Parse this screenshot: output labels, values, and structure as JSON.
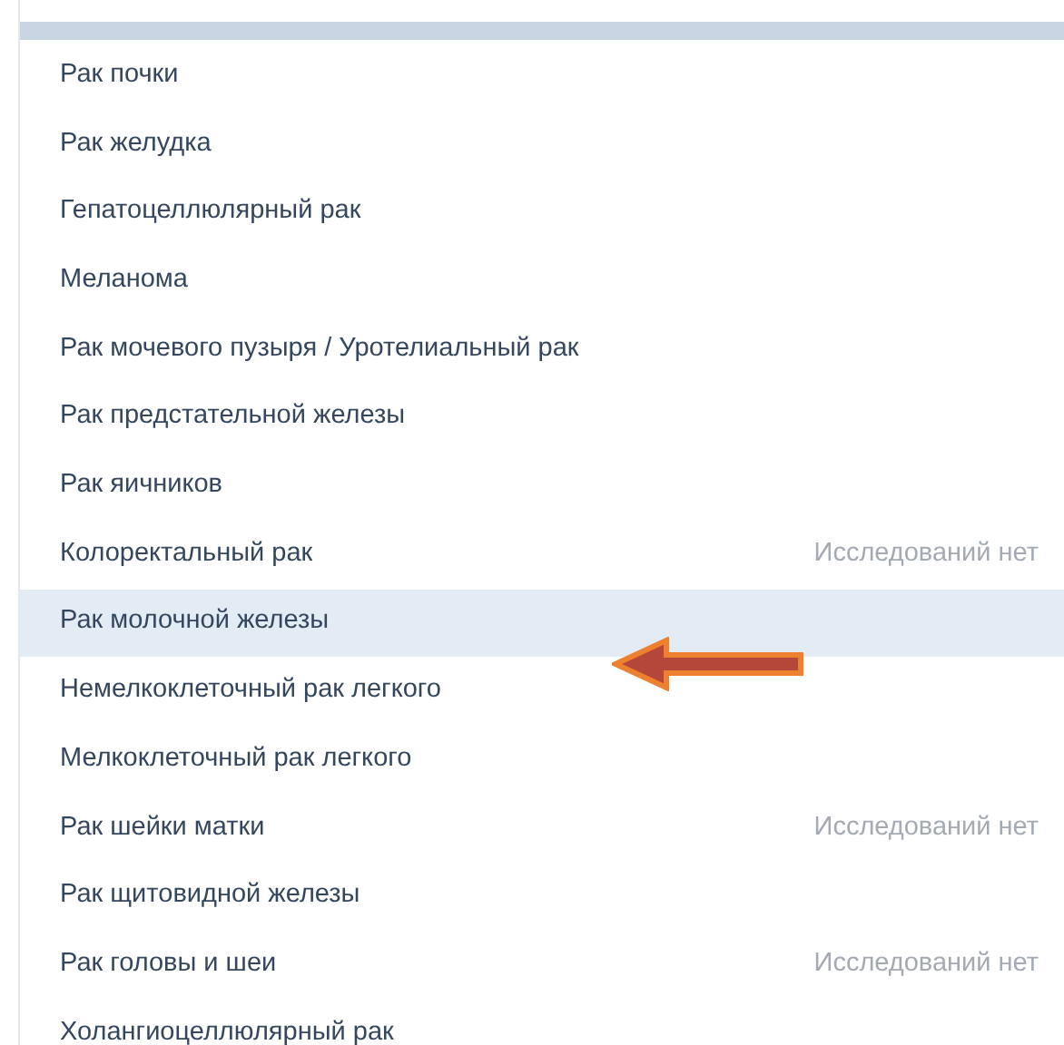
{
  "list": [
    {
      "label": "Рак почки",
      "selected": false
    },
    {
      "label": "Рак желудка",
      "selected": false
    },
    {
      "label": "Гепатоцеллюлярный рак",
      "selected": false
    },
    {
      "label": "Меланома",
      "selected": false
    },
    {
      "label": "Рак мочевого пузыря / Уротелиальный рак",
      "selected": false
    },
    {
      "label": "Рак предстательной железы",
      "selected": false
    },
    {
      "label": "Рак яичников",
      "selected": false
    },
    {
      "label": "Колоректальный рак",
      "note": "Исследований нет",
      "selected": false
    },
    {
      "label": "Рак молочной железы",
      "selected": true
    },
    {
      "label": "Немелкоклеточный рак легкого",
      "selected": false
    },
    {
      "label": "Мелкоклеточный рак легкого",
      "selected": false
    },
    {
      "label": "Рак шейки матки",
      "note": "Исследований нет",
      "selected": false
    },
    {
      "label": "Рак щитовидной железы",
      "selected": false
    },
    {
      "label": "Рак головы и шеи",
      "note": "Исследований нет",
      "selected": false
    },
    {
      "label": "Холангиоцеллюлярный рак",
      "selected": false
    }
  ]
}
